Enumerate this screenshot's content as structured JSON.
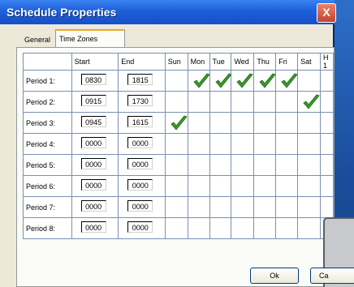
{
  "window": {
    "title": "Schedule Properties",
    "close_label": "X"
  },
  "background_window": {
    "fragment": "Ca"
  },
  "tabs": [
    {
      "label": "General",
      "selected": false
    },
    {
      "label": "Time Zones",
      "selected": true
    }
  ],
  "grid": {
    "headers": [
      "Start",
      "End",
      "Sun",
      "Mon",
      "Tue",
      "Wed",
      "Thu",
      "Fri",
      "Sat",
      "H 1"
    ],
    "rows": [
      {
        "label": "Period 1:",
        "start": "0830",
        "end": "1815",
        "days": [
          false,
          true,
          true,
          true,
          true,
          true,
          false,
          false
        ]
      },
      {
        "label": "Period 2:",
        "start": "0915",
        "end": "1730",
        "days": [
          false,
          false,
          false,
          false,
          false,
          false,
          true,
          false
        ]
      },
      {
        "label": "Period 3:",
        "start": "0945",
        "end": "1615",
        "days": [
          true,
          false,
          false,
          false,
          false,
          false,
          false,
          false
        ]
      },
      {
        "label": "Period 4:",
        "start": "0000",
        "end": "0000",
        "days": [
          false,
          false,
          false,
          false,
          false,
          false,
          false,
          false
        ]
      },
      {
        "label": "Period 5:",
        "start": "0000",
        "end": "0000",
        "days": [
          false,
          false,
          false,
          false,
          false,
          false,
          false,
          false
        ]
      },
      {
        "label": "Period 6:",
        "start": "0000",
        "end": "0000",
        "days": [
          false,
          false,
          false,
          false,
          false,
          false,
          false,
          false
        ]
      },
      {
        "label": "Period 7:",
        "start": "0000",
        "end": "0000",
        "days": [
          false,
          false,
          false,
          false,
          false,
          false,
          false,
          false
        ]
      },
      {
        "label": "Period 8:",
        "start": "0000",
        "end": "0000",
        "days": [
          false,
          false,
          false,
          false,
          false,
          false,
          false,
          false
        ]
      }
    ]
  },
  "buttons": {
    "ok": "Ok",
    "cancel": "Ca"
  },
  "colors": {
    "check": "#3a9a2a",
    "title_bar": "#1e5fd8",
    "grid_line": "#7d8fb0"
  },
  "icons": {
    "day_checked": "check-icon"
  }
}
